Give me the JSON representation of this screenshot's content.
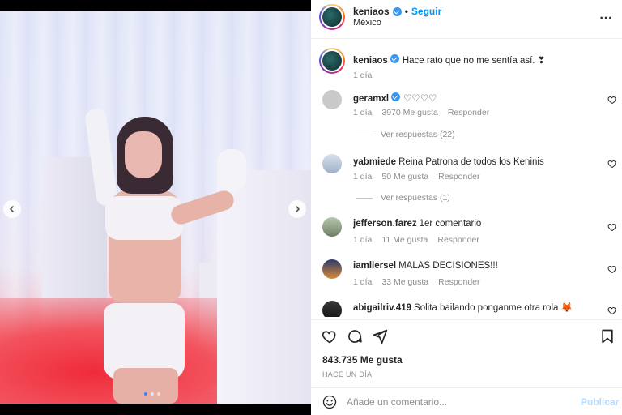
{
  "post": {
    "username": "keniaos",
    "follow_label": "Seguir",
    "separator": "•",
    "location": "México",
    "more_icon": "more-horizontal-icon"
  },
  "caption": {
    "username": "keniaos",
    "text": "Hace rato que no me sentía así. ❣",
    "time": "1 día"
  },
  "comments": [
    {
      "username": "geramxl",
      "text": "♡♡♡♡",
      "time": "1 día",
      "likes": "3970 Me gusta",
      "reply": "Responder",
      "verified": true,
      "view_replies": "Ver respuestas (22)"
    },
    {
      "username": "yabmiede",
      "text": "Reina Patrona de todos los Keninis",
      "time": "1 día",
      "likes": "50 Me gusta",
      "reply": "Responder",
      "verified": false,
      "view_replies": "Ver respuestas (1)"
    },
    {
      "username": "jefferson.farez",
      "text": "1er comentario",
      "time": "1 día",
      "likes": "11 Me gusta",
      "reply": "Responder",
      "verified": false
    },
    {
      "username": "iamllersel",
      "text": "MALAS DECISIONES!!!",
      "time": "1 día",
      "likes": "33 Me gusta",
      "reply": "Responder",
      "verified": false
    },
    {
      "username": "abigailriv.419",
      "text": "Solita bailando ponganme otra rola 🦊",
      "verified": false
    }
  ],
  "engagement": {
    "likes": "843.735 Me gusta",
    "time": "HACE UN DÍA"
  },
  "composer": {
    "placeholder": "Añade un comentario...",
    "post_label": "Publicar"
  },
  "carousel": {
    "slide_count": 3,
    "active_index": 0
  },
  "colors": {
    "accent": "#0095f6",
    "verified": "#3897f0",
    "muted": "#8e8e8e"
  }
}
